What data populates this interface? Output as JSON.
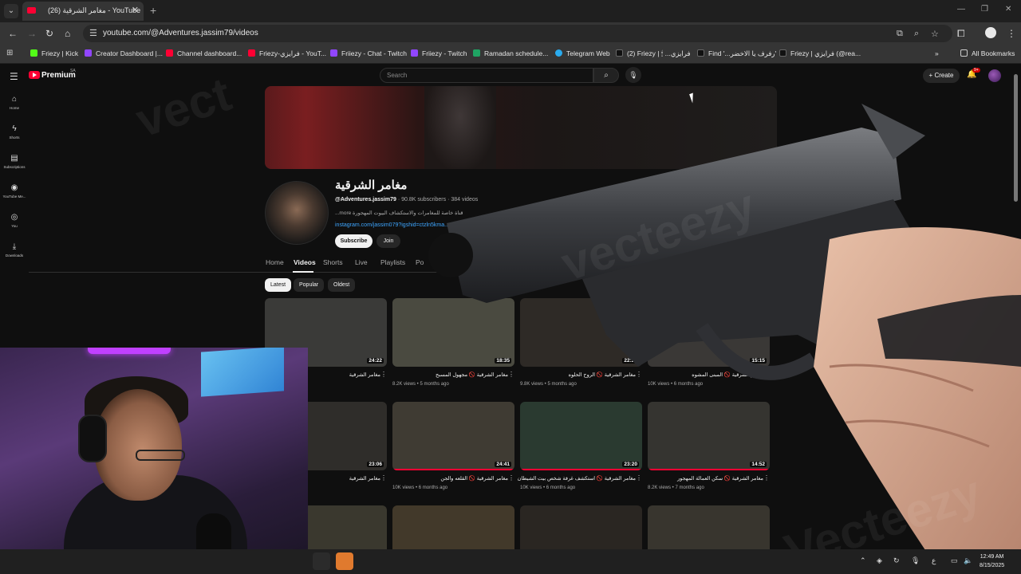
{
  "browser": {
    "tab_title": "مغامر الشرقية (26) - YouTube",
    "url": "youtube.com/@Adventures.jassim79/videos",
    "bookmarks": [
      {
        "label": "Friezy | Kick",
        "color": "#53fc18"
      },
      {
        "label": "Creator Dashboard |...",
        "color": "#9146ff"
      },
      {
        "label": "Channel dashboard...",
        "color": "#ff0033"
      },
      {
        "label": "Friezy-فرايزي - YouT...",
        "color": "#ff0033"
      },
      {
        "label": "Friiezy - Chat - Twitch",
        "color": "#9146ff"
      },
      {
        "label": "Friiezy - Twitch",
        "color": "#9146ff"
      },
      {
        "label": "Ramadan schedule...",
        "color": "#1fa463"
      },
      {
        "label": "Telegram Web",
        "color": "#2aabee"
      },
      {
        "label": "(2) Friezy | 🕯 ...فرايزي",
        "color": "#000000"
      },
      {
        "label": "Find '...رفرف يا الاخضر'",
        "color": "#000000"
      },
      {
        "label": "Friezy | فرايزي (@rea...",
        "color": "#000000"
      }
    ],
    "all_bookmarks": "All Bookmarks"
  },
  "youtube": {
    "logo_text": "Premium",
    "country_code": "SA",
    "search_placeholder": "Search",
    "create_label": "Create",
    "notif_badge": "9+",
    "sidebar": [
      {
        "label": "Home",
        "icon": "home-icon",
        "glyph": "⌂"
      },
      {
        "label": "Shorts",
        "icon": "shorts-icon",
        "glyph": "ϟ"
      },
      {
        "label": "Subscriptions",
        "icon": "subscriptions-icon",
        "glyph": "▤"
      },
      {
        "label": "YouTube Me...",
        "icon": "you-icon",
        "glyph": "◉"
      },
      {
        "label": "You",
        "icon": "user-icon",
        "glyph": "◎"
      },
      {
        "label": "Downloads",
        "icon": "download-icon",
        "glyph": "⤓"
      }
    ],
    "channel": {
      "name": "مغامر الشرقية",
      "handle": "@Adventures.jassim79",
      "subscribers": "90.8K subscribers",
      "videos_count": "384 videos",
      "description": "...more  قناة خاصة للمغامرات والاستكشاف البيوت المهجورة",
      "link": "instagram.com/jassim079?igshid=ctzln5kma...",
      "subscribe": "Subscribe",
      "join": "Join"
    },
    "tabs": [
      "Home",
      "Videos",
      "Shorts",
      "Live",
      "Playlists",
      "Po"
    ],
    "active_tab": "Videos",
    "chips": [
      "Latest",
      "Popular",
      "Oldest"
    ],
    "videos": [
      {
        "title": "مغامر الشرقية",
        "meta": "ago",
        "duration": "24:22",
        "progress": 0.0,
        "thumb": "#3a3a38"
      },
      {
        "title": "مغامر الشرقية 🚫 مجهول المسبح",
        "meta": "8.2K views • 5 months ago",
        "duration": "18:35",
        "progress": 0.0,
        "thumb": "#4a4a40"
      },
      {
        "title": "مغامر الشرقية 🚫 الروح الحلوه",
        "meta": "9.8K views • 5 months ago",
        "duration": "22:26",
        "progress": 0.0,
        "thumb": "#2e2a26"
      },
      {
        "title": "مغامر الشرقية 🚫 المبنى المشوه",
        "meta": "10K views • 6 months ago",
        "duration": "15:15",
        "progress": 0.0,
        "thumb": "#3a3836"
      },
      {
        "title": "مغامر الشرقية",
        "meta": "ago",
        "duration": "23:06",
        "progress": 0.0,
        "thumb": "#2f2d2a"
      },
      {
        "title": "مغامر الشرقية 🚫 القلعه والجن",
        "meta": "10K views • 6 months ago",
        "duration": "24:41",
        "progress": 1.0,
        "thumb": "#3f3b33"
      },
      {
        "title": "مغامر الشرقية 🚫 استكشف غرفة شخص بيت الشيطان",
        "meta": "10K views • 6 months ago",
        "duration": "23:20",
        "progress": 1.0,
        "thumb": "#2a3a30"
      },
      {
        "title": "مغامر الشرقية 🚫 سكن العمالة المهجور",
        "meta": "8.2K views • 7 months ago",
        "duration": "14:52",
        "progress": 1.0,
        "thumb": "#353430"
      }
    ]
  },
  "taskbar": {
    "time": "12:49 AM",
    "date": "8/15/2025",
    "lang": "ع"
  },
  "watermarks": [
    "Vecteezy",
    "vect",
    "vecteezy"
  ]
}
